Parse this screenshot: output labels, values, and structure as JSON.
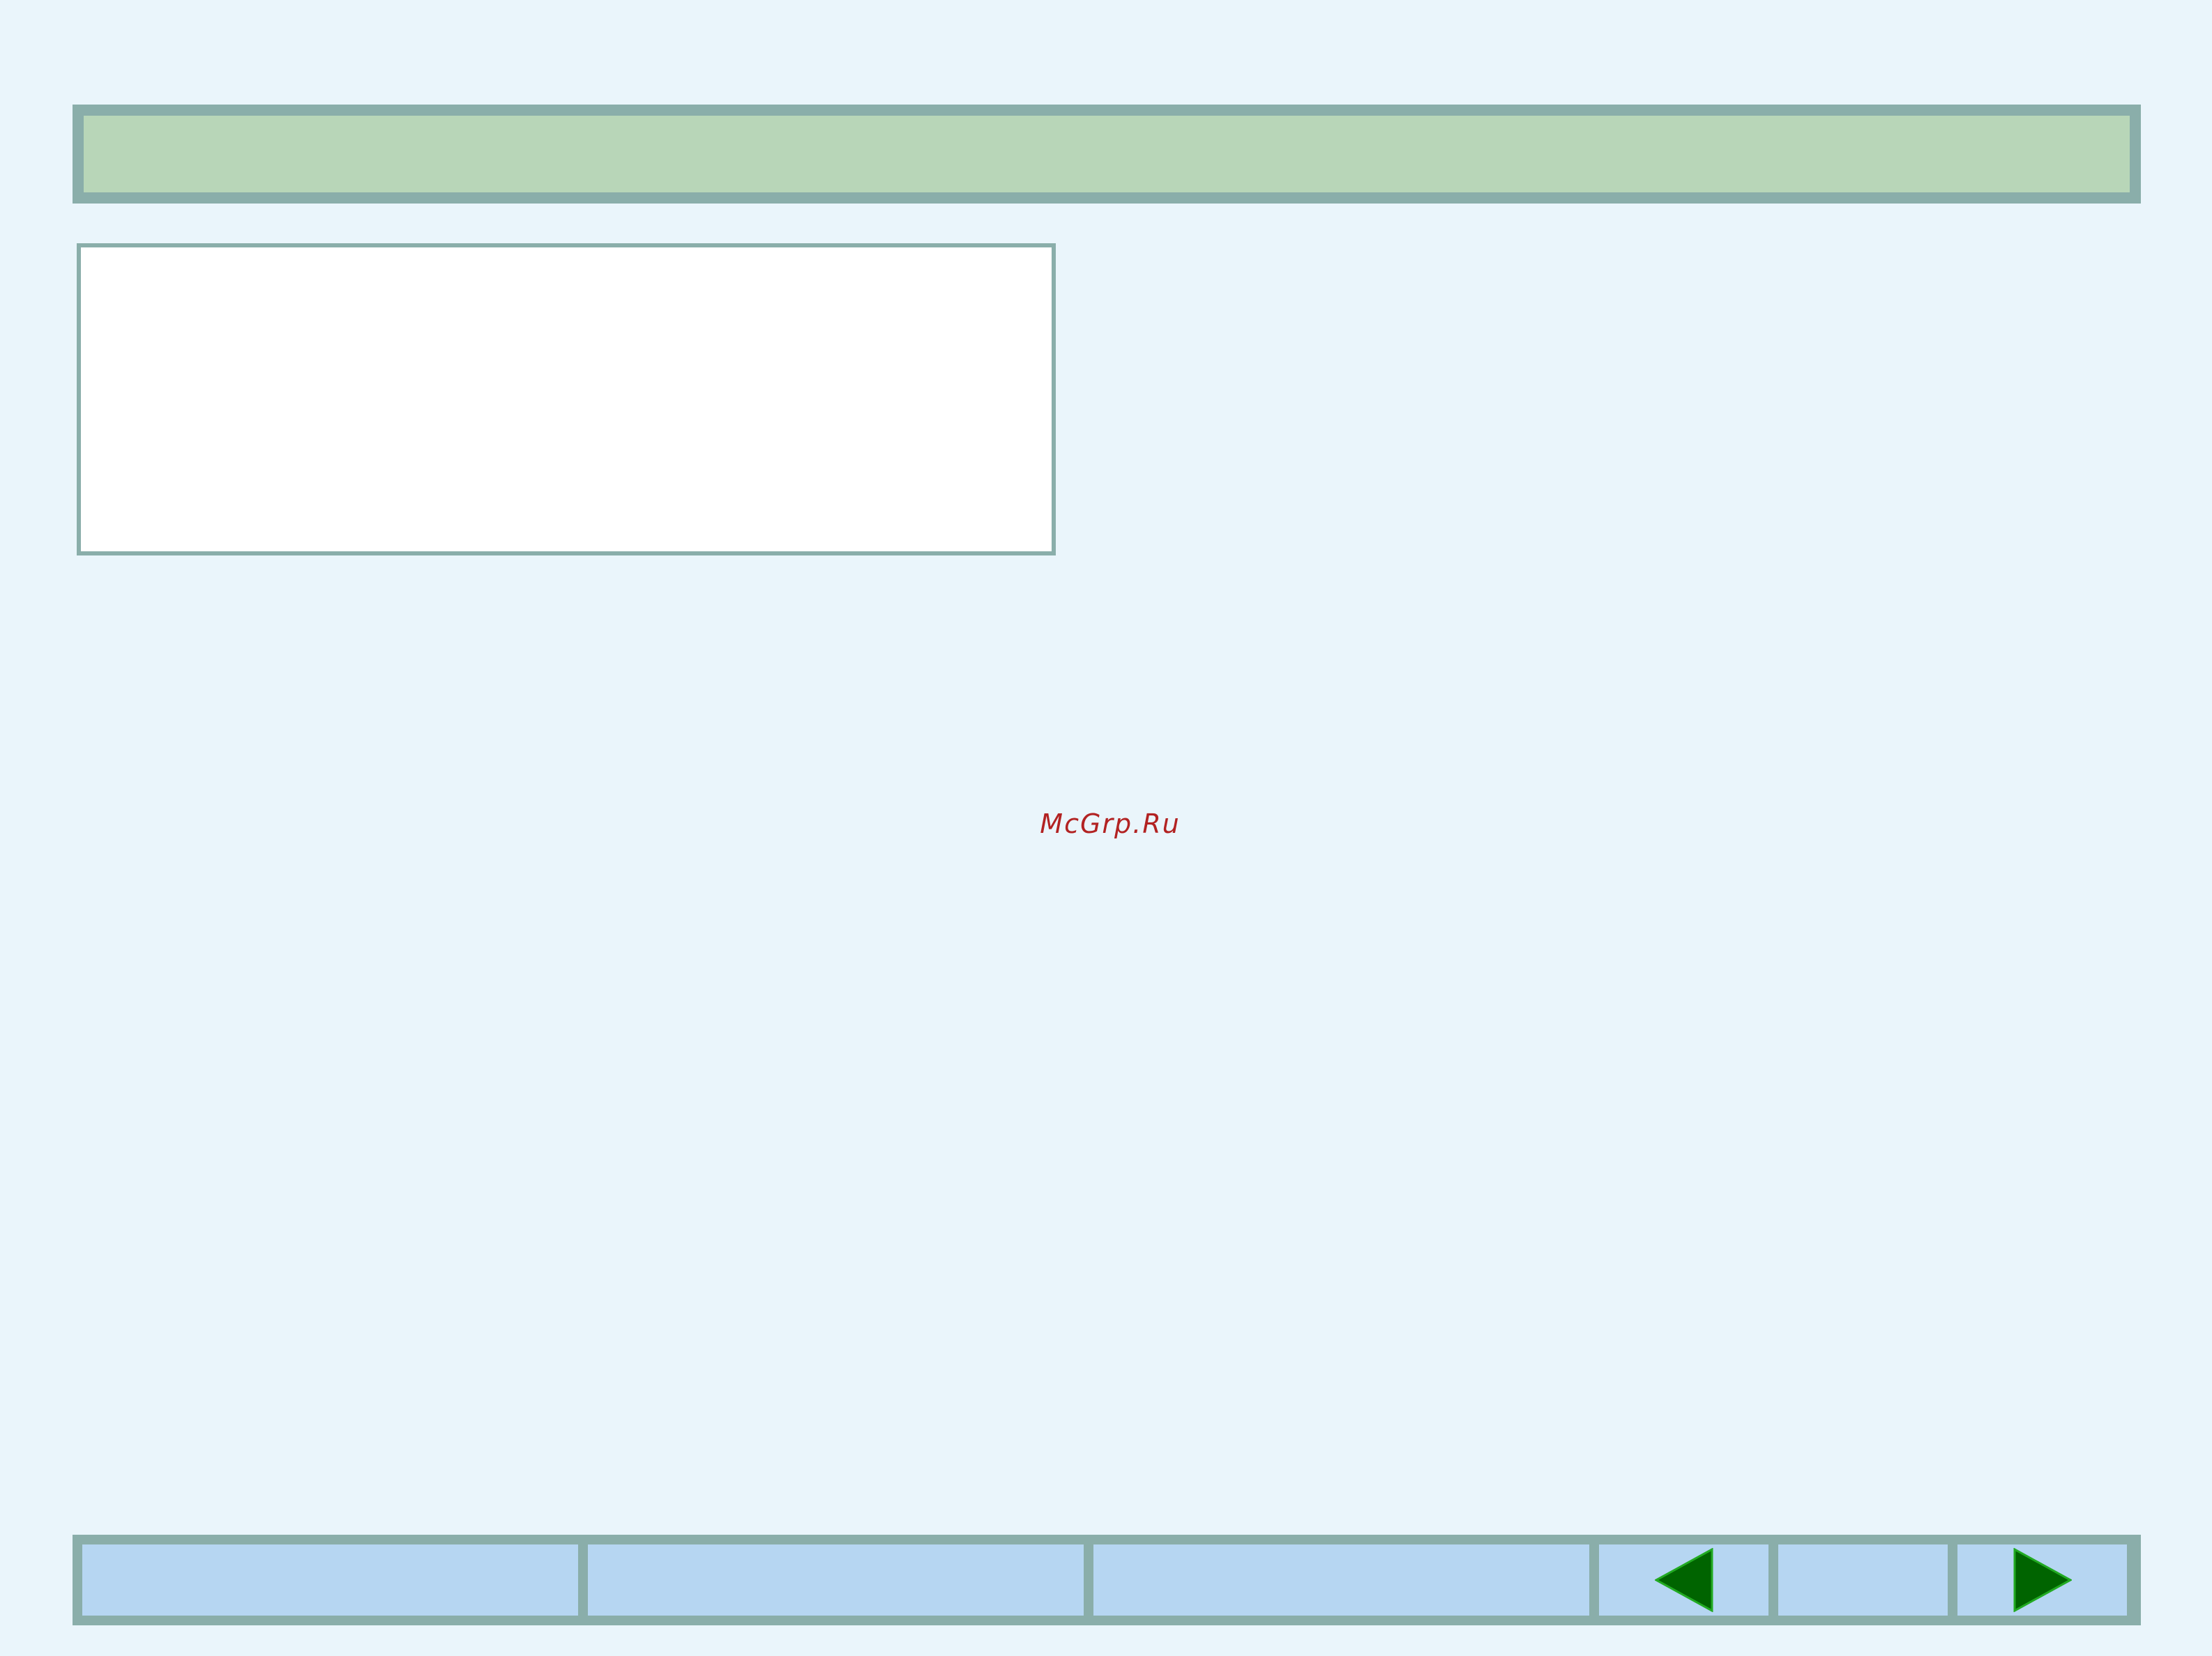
{
  "watermark": {
    "text": "McGrp.Ru"
  },
  "icons": {
    "prev": "triangle-left-icon",
    "next": "triangle-right-icon"
  },
  "colors": {
    "background": "#eaf5fb",
    "title_bar_fill": "#b8d6b8",
    "frame_border": "#8aaeaa",
    "content_fill": "#ffffff",
    "nav_cell_fill": "#b6d6f2",
    "arrow_fill": "#006400",
    "arrow_edge": "#22aa22",
    "watermark": "#b22222"
  }
}
